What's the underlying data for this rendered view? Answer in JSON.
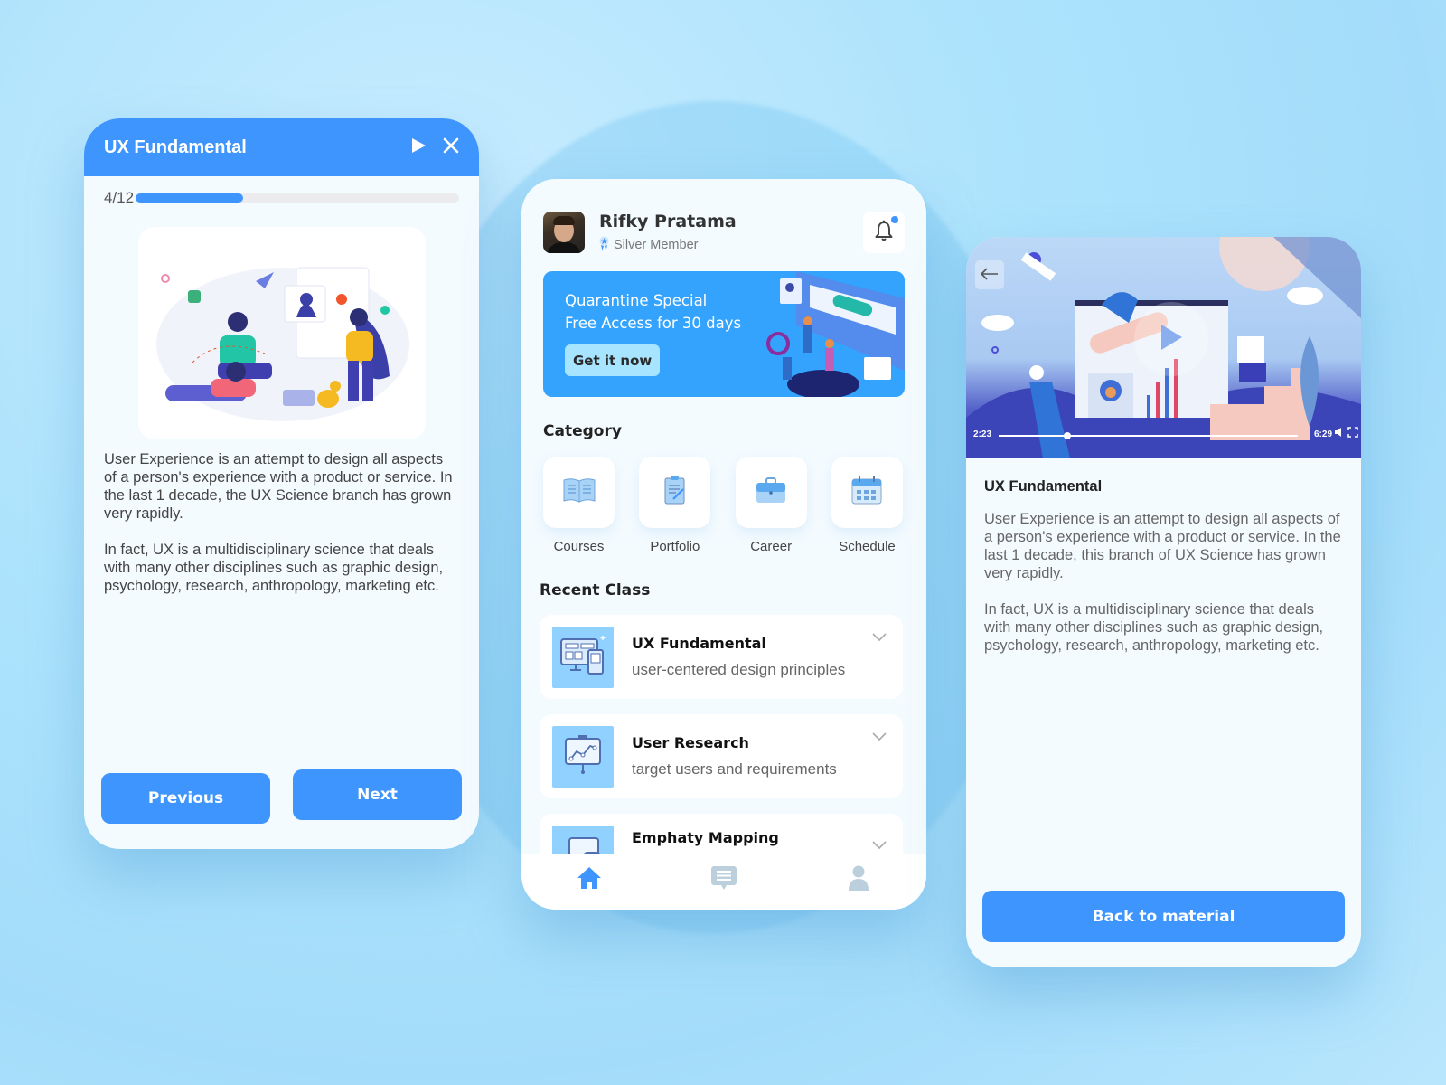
{
  "colors": {
    "primary": "#3f95fe",
    "banner": "#33a3fd",
    "banner_button": "#a6e4ff",
    "thumb_bg": "#90d1ff",
    "card_bg": "#f4fbff"
  },
  "lesson_card": {
    "title": "UX Fundamental",
    "header_icons": [
      "play-icon",
      "close-icon"
    ],
    "progress": {
      "label": "4/12",
      "current": 4,
      "total": 12
    },
    "illustration": "team-collaboration-illustration",
    "paragraphs": [
      "User Experience is an attempt to design all aspects of a person's experience with a product or service. In the last 1 decade, the UX Science branch has grown very rapidly.",
      "In fact, UX is a multidisciplinary science that deals with many other disciplines such as graphic design, psychology, research, anthropology, marketing etc."
    ],
    "previous_label": "Previous",
    "next_label": "Next"
  },
  "home_card": {
    "user": {
      "name": "Rifky Pratama",
      "level": "Silver Member"
    },
    "notification": {
      "icon": "bell-icon",
      "has_unread": true
    },
    "banner": {
      "line1": "Quarantine Special",
      "line2": "Free Access for 30 days",
      "button_label": "Get it now"
    },
    "category_title": "Category",
    "categories": [
      {
        "label": "Courses",
        "icon": "book-icon"
      },
      {
        "label": "Portfolio",
        "icon": "clipboard-icon"
      },
      {
        "label": "Career",
        "icon": "briefcase-icon"
      },
      {
        "label": "Schedule",
        "icon": "calendar-icon"
      }
    ],
    "recent_title": "Recent Class",
    "recent_classes": [
      {
        "title": "UX Fundamental",
        "subtitle": "user-centered design principles",
        "icon": "devices-icon"
      },
      {
        "title": "User Research",
        "subtitle": "target users and requirements",
        "icon": "presentation-chart-icon"
      },
      {
        "title": "Emphaty Mapping",
        "subtitle": "",
        "icon": "chat-bubbles-icon"
      }
    ],
    "bottom_nav": [
      {
        "name": "home",
        "icon": "home-icon",
        "active": true
      },
      {
        "name": "messages",
        "icon": "message-icon",
        "active": false
      },
      {
        "name": "profile",
        "icon": "user-icon",
        "active": false
      }
    ]
  },
  "video_card": {
    "video": {
      "current_time": "2:23",
      "duration": "6:29",
      "progress_fraction": 0.23
    },
    "title": "UX Fundamental",
    "paragraphs": [
      "User Experience is an attempt to design all aspects of a person's experience with a product or service. In the last 1 decade, this branch of UX Science has grown very rapidly.",
      "In fact, UX is a multidisciplinary science that deals with many other disciplines such as graphic design, psychology, research, anthropology, marketing etc."
    ],
    "button_label": "Back to material"
  }
}
